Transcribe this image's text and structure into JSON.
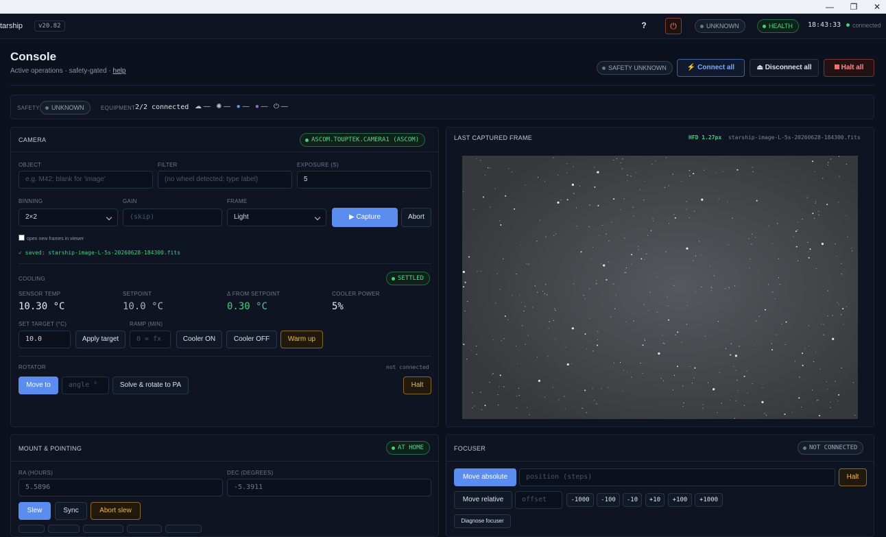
{
  "window": {
    "minimize_icon": "minimize-icon",
    "maximize_icon": "maximize-icon",
    "close_icon": "close-icon"
  },
  "topbar": {
    "app_name": "tarship",
    "version": "v20.82",
    "help_icon": "?",
    "unknown_pill": "UNKNOWN",
    "health_pill": "HEALTH",
    "clock": "18:43:33",
    "status": "connected"
  },
  "header": {
    "title": "Console",
    "subtitle": "Active operations · safety-gated ·",
    "help_link": "help",
    "safety_pill": "SAFETY UNKNOWN",
    "connect_all": "Connect all",
    "disconnect_all": "Disconnect all",
    "halt_all": "Halt all"
  },
  "status_strip": {
    "safety_label": "SAFETY",
    "safety_value": "UNKNOWN",
    "equipment_label": "EQUIPMENT",
    "equipment_value": "2/2 connected",
    "weather": [
      {
        "icon": "cloud-icon",
        "glyph": "☁",
        "value": "—"
      },
      {
        "icon": "wind-icon",
        "glyph": "✺",
        "value": "—"
      },
      {
        "icon": "humidity-icon",
        "glyph": "💧",
        "value": "—"
      },
      {
        "icon": "sky-icon",
        "glyph": "●",
        "value": "—"
      },
      {
        "icon": "power-icon",
        "glyph": "⏻",
        "value": "—"
      }
    ]
  },
  "camera": {
    "title": "CAMERA",
    "device_badge": "ASCOM.TOUPTEK.CAMERA1 (ASCOM)",
    "object_label": "OBJECT",
    "object_placeholder": "e.g. M42; blank for 'image'",
    "filter_label": "FILTER",
    "filter_placeholder": "(no wheel detected; type label)",
    "exposure_label": "EXPOSURE (S)",
    "exposure_value": "5",
    "binning_label": "BINNING",
    "binning_value": "2×2",
    "gain_label": "GAIN",
    "gain_placeholder": "(skip)",
    "frame_label": "FRAME",
    "frame_value": "Light",
    "capture": "▶ Capture",
    "abort": "Abort",
    "open_frames_label": "open new frames in viewer",
    "saved_msg": "✓ saved: starship-image-L-5s-20260628-184300.fits"
  },
  "cooling": {
    "title": "COOLING",
    "badge": "SETTLED",
    "sensor_label": "SENSOR TEMP",
    "sensor_value": "10.30 °C",
    "setpoint_label": "SETPOINT",
    "setpoint_value": "10.0 °C",
    "delta_label": "Δ FROM SETPOINT",
    "delta_value": "0.30 °C",
    "power_label": "COOLER POWER",
    "power_value": "5%",
    "target_label": "SET TARGET (°C)",
    "target_value": "10.0",
    "apply": "Apply target",
    "ramp_label": "RAMP (MIN)",
    "ramp_placeholder": "0 = fx",
    "cooler_on": "Cooler ON",
    "cooler_off": "Cooler OFF",
    "warm_up": "Warm up",
    "colors": {
      "delta": "#43d17f"
    }
  },
  "rotator": {
    "title": "ROTATOR",
    "status": "not connected",
    "move_to": "Move to",
    "angle_placeholder": "angle °",
    "solve_rotate": "Solve & rotate to PA",
    "halt": "Halt"
  },
  "frame_panel": {
    "title": "LAST CAPTURED FRAME",
    "hfd": "HFD 1.27px",
    "filename": "starship-image-L-5s-20260628-184300.fits"
  },
  "mount": {
    "title": "MOUNT & POINTING",
    "badge": "AT HOME",
    "ra_label": "RA (HOURS)",
    "ra_value": "5.5896",
    "dec_label": "DEC (DEGREES)",
    "dec_value": "-5.3911",
    "slew": "Slew",
    "sync": "Sync",
    "abort_slew": "Abort slew"
  },
  "focuser": {
    "title": "FOCUSER",
    "badge": "NOT CONNECTED",
    "move_absolute": "Move absolute",
    "position_placeholder": "position (steps)",
    "halt": "Halt",
    "move_relative": "Move relative",
    "offset_placeholder": "offset",
    "steps": [
      "-1000",
      "-100",
      "-10",
      "+10",
      "+100",
      "+1000"
    ],
    "diagnose": "Diagnose focuser"
  }
}
